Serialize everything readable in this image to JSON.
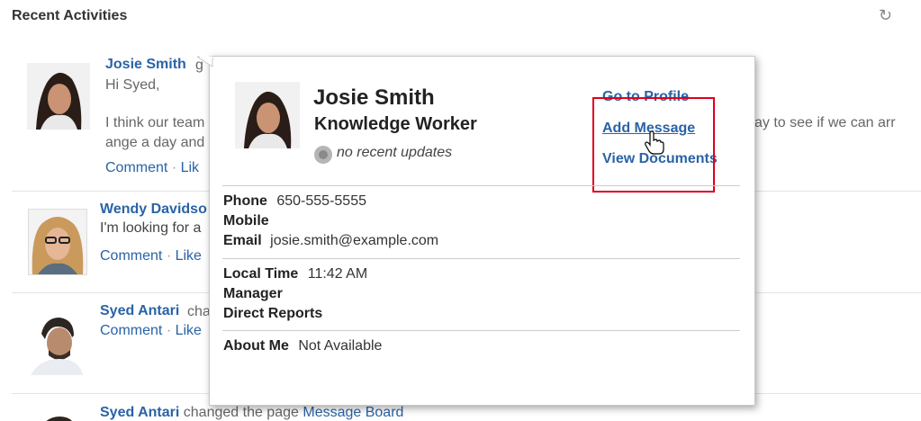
{
  "header": {
    "title": "Recent Activities",
    "refresh_icon": "↻"
  },
  "activities": [
    {
      "name": "Josie Smith",
      "after_name": "g",
      "line1": "Hi Syed,",
      "line2": "I think our team",
      "line2_right": "ay to see if we can arr",
      "line3": "ange a day and",
      "comment": "Comment",
      "sep": "·",
      "like": "Lik"
    },
    {
      "name": "Wendy Davidso",
      "line1": "I'm looking for a",
      "comment": "Comment",
      "sep": "·",
      "like": "Like"
    },
    {
      "name": "Syed Antari",
      "after_name": "cha",
      "comment": "Comment",
      "sep": "·",
      "like": "Like"
    },
    {
      "name": "Syed Antari",
      "after_name": "changed the page",
      "page_link": "Message Board"
    }
  ],
  "profile_card": {
    "name": "Josie Smith",
    "role": "Knowledge Worker",
    "status": "no recent updates",
    "actions": {
      "go_to_profile": "Go to Profile",
      "add_message": "Add Message",
      "view_documents": "View Documents"
    },
    "phone_label": "Phone",
    "phone": "650-555-5555",
    "mobile_label": "Mobile",
    "email_label": "Email",
    "email": "josie.smith@example.com",
    "local_time_label": "Local Time",
    "local_time": "11:42 AM",
    "manager_label": "Manager",
    "direct_reports_label": "Direct Reports",
    "about_me_label": "About Me",
    "about_me": "Not Available"
  },
  "colors": {
    "link": "#2a63a6",
    "highlight": "#e0001b"
  }
}
